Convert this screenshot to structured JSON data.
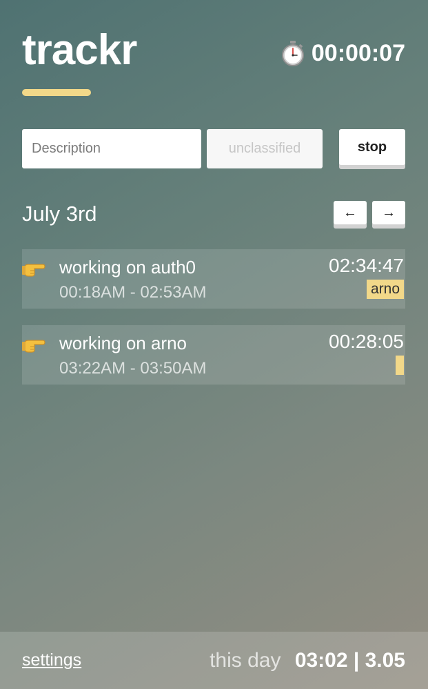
{
  "app": {
    "title": "trackr",
    "accent_color": "#f2d889"
  },
  "timer": {
    "icon": "stopwatch-icon",
    "elapsed": "00:00:07"
  },
  "controls": {
    "description_placeholder": "Description",
    "category_placeholder": "unclassified",
    "stop_label": "stop"
  },
  "day": {
    "label": "July 3rd",
    "prev_label": "←",
    "next_label": "→"
  },
  "entries": [
    {
      "icon": "pointing-hand-icon",
      "title": "working on auth0",
      "range": "00:18AM - 02:53AM",
      "duration": "02:34:47",
      "tag": "arno"
    },
    {
      "icon": "pointing-hand-icon",
      "title": "working on arno",
      "range": "03:22AM - 03:50AM",
      "duration": "00:28:05",
      "tag": ""
    }
  ],
  "footer": {
    "settings_label": "settings",
    "summary_label": "this day",
    "summary_value": "03:02 | 3.05"
  }
}
